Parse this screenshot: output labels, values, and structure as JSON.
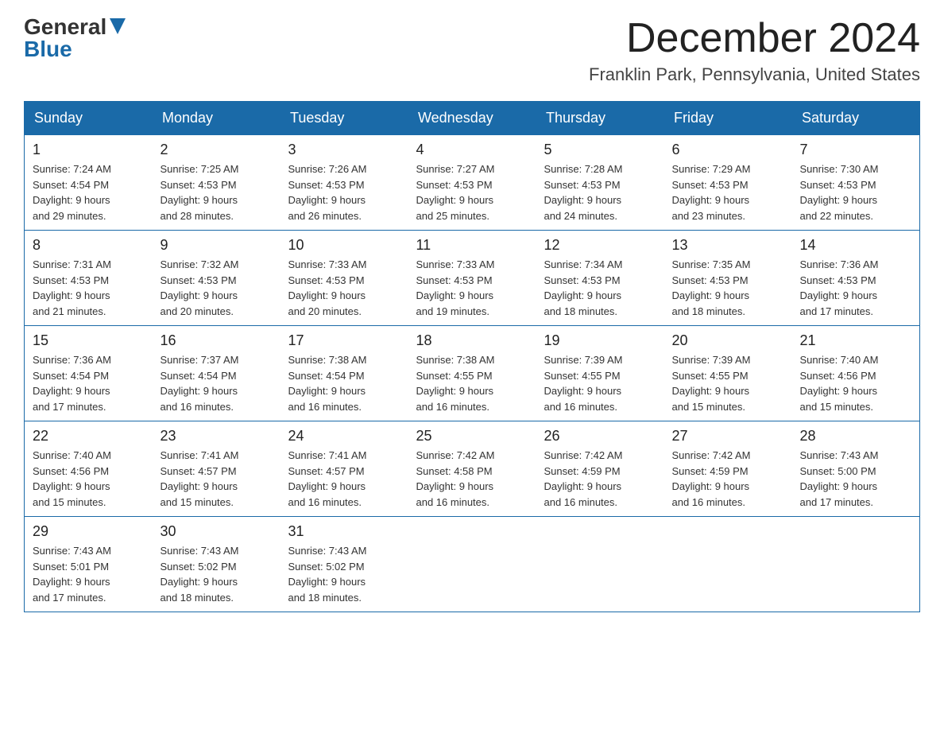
{
  "logo": {
    "general": "General",
    "blue": "Blue"
  },
  "title": {
    "month_year": "December 2024",
    "location": "Franklin Park, Pennsylvania, United States"
  },
  "weekdays": [
    "Sunday",
    "Monday",
    "Tuesday",
    "Wednesday",
    "Thursday",
    "Friday",
    "Saturday"
  ],
  "weeks": [
    [
      {
        "day": "1",
        "sunrise": "7:24 AM",
        "sunset": "4:54 PM",
        "daylight": "9 hours and 29 minutes."
      },
      {
        "day": "2",
        "sunrise": "7:25 AM",
        "sunset": "4:53 PM",
        "daylight": "9 hours and 28 minutes."
      },
      {
        "day": "3",
        "sunrise": "7:26 AM",
        "sunset": "4:53 PM",
        "daylight": "9 hours and 26 minutes."
      },
      {
        "day": "4",
        "sunrise": "7:27 AM",
        "sunset": "4:53 PM",
        "daylight": "9 hours and 25 minutes."
      },
      {
        "day": "5",
        "sunrise": "7:28 AM",
        "sunset": "4:53 PM",
        "daylight": "9 hours and 24 minutes."
      },
      {
        "day": "6",
        "sunrise": "7:29 AM",
        "sunset": "4:53 PM",
        "daylight": "9 hours and 23 minutes."
      },
      {
        "day": "7",
        "sunrise": "7:30 AM",
        "sunset": "4:53 PM",
        "daylight": "9 hours and 22 minutes."
      }
    ],
    [
      {
        "day": "8",
        "sunrise": "7:31 AM",
        "sunset": "4:53 PM",
        "daylight": "9 hours and 21 minutes."
      },
      {
        "day": "9",
        "sunrise": "7:32 AM",
        "sunset": "4:53 PM",
        "daylight": "9 hours and 20 minutes."
      },
      {
        "day": "10",
        "sunrise": "7:33 AM",
        "sunset": "4:53 PM",
        "daylight": "9 hours and 20 minutes."
      },
      {
        "day": "11",
        "sunrise": "7:33 AM",
        "sunset": "4:53 PM",
        "daylight": "9 hours and 19 minutes."
      },
      {
        "day": "12",
        "sunrise": "7:34 AM",
        "sunset": "4:53 PM",
        "daylight": "9 hours and 18 minutes."
      },
      {
        "day": "13",
        "sunrise": "7:35 AM",
        "sunset": "4:53 PM",
        "daylight": "9 hours and 18 minutes."
      },
      {
        "day": "14",
        "sunrise": "7:36 AM",
        "sunset": "4:53 PM",
        "daylight": "9 hours and 17 minutes."
      }
    ],
    [
      {
        "day": "15",
        "sunrise": "7:36 AM",
        "sunset": "4:54 PM",
        "daylight": "9 hours and 17 minutes."
      },
      {
        "day": "16",
        "sunrise": "7:37 AM",
        "sunset": "4:54 PM",
        "daylight": "9 hours and 16 minutes."
      },
      {
        "day": "17",
        "sunrise": "7:38 AM",
        "sunset": "4:54 PM",
        "daylight": "9 hours and 16 minutes."
      },
      {
        "day": "18",
        "sunrise": "7:38 AM",
        "sunset": "4:55 PM",
        "daylight": "9 hours and 16 minutes."
      },
      {
        "day": "19",
        "sunrise": "7:39 AM",
        "sunset": "4:55 PM",
        "daylight": "9 hours and 16 minutes."
      },
      {
        "day": "20",
        "sunrise": "7:39 AM",
        "sunset": "4:55 PM",
        "daylight": "9 hours and 15 minutes."
      },
      {
        "day": "21",
        "sunrise": "7:40 AM",
        "sunset": "4:56 PM",
        "daylight": "9 hours and 15 minutes."
      }
    ],
    [
      {
        "day": "22",
        "sunrise": "7:40 AM",
        "sunset": "4:56 PM",
        "daylight": "9 hours and 15 minutes."
      },
      {
        "day": "23",
        "sunrise": "7:41 AM",
        "sunset": "4:57 PM",
        "daylight": "9 hours and 15 minutes."
      },
      {
        "day": "24",
        "sunrise": "7:41 AM",
        "sunset": "4:57 PM",
        "daylight": "9 hours and 16 minutes."
      },
      {
        "day": "25",
        "sunrise": "7:42 AM",
        "sunset": "4:58 PM",
        "daylight": "9 hours and 16 minutes."
      },
      {
        "day": "26",
        "sunrise": "7:42 AM",
        "sunset": "4:59 PM",
        "daylight": "9 hours and 16 minutes."
      },
      {
        "day": "27",
        "sunrise": "7:42 AM",
        "sunset": "4:59 PM",
        "daylight": "9 hours and 16 minutes."
      },
      {
        "day": "28",
        "sunrise": "7:43 AM",
        "sunset": "5:00 PM",
        "daylight": "9 hours and 17 minutes."
      }
    ],
    [
      {
        "day": "29",
        "sunrise": "7:43 AM",
        "sunset": "5:01 PM",
        "daylight": "9 hours and 17 minutes."
      },
      {
        "day": "30",
        "sunrise": "7:43 AM",
        "sunset": "5:02 PM",
        "daylight": "9 hours and 18 minutes."
      },
      {
        "day": "31",
        "sunrise": "7:43 AM",
        "sunset": "5:02 PM",
        "daylight": "9 hours and 18 minutes."
      },
      null,
      null,
      null,
      null
    ]
  ],
  "labels": {
    "sunrise": "Sunrise:",
    "sunset": "Sunset:",
    "daylight": "Daylight:"
  }
}
